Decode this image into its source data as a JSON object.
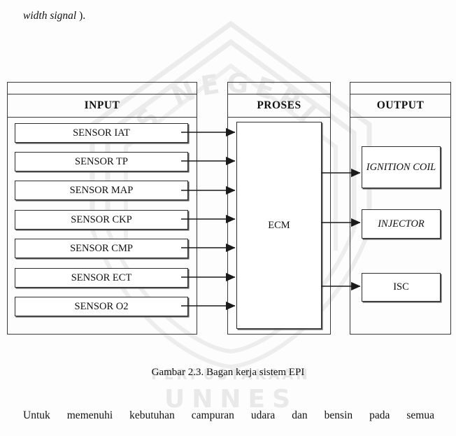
{
  "document": {
    "top_continuation": {
      "italic_part": "width signal",
      "tail": ")."
    },
    "caption": "Gambar 2.3. Bagan kerja sistem EPI",
    "body_paragraph": "Untuk memenuhi kebutuhan campuran udara dan bensin pada semua"
  },
  "watermark": {
    "arc_text": "S NEGERI",
    "line1": "PERPUSTAKAAN",
    "line2": "UNNES"
  },
  "diagram": {
    "columns": [
      {
        "id": "input",
        "title": "INPUT"
      },
      {
        "id": "proses",
        "title": "PROSES"
      },
      {
        "id": "output",
        "title": "OUTPUT"
      }
    ],
    "input_items": [
      "SENSOR IAT",
      "SENSOR TP",
      "SENSOR MAP",
      "SENSOR CKP",
      "SENSOR CMP",
      "SENSOR ECT",
      "SENSOR O2"
    ],
    "process_items": [
      "ECM"
    ],
    "output_items": [
      "IGNITION COIL",
      "INJECTOR",
      "ISC"
    ],
    "colors": {
      "border": "#2e2e2e",
      "outer_border": "#3a3a3a",
      "shadow": "#555555",
      "text": "#111111",
      "background": "#ffffff"
    }
  }
}
